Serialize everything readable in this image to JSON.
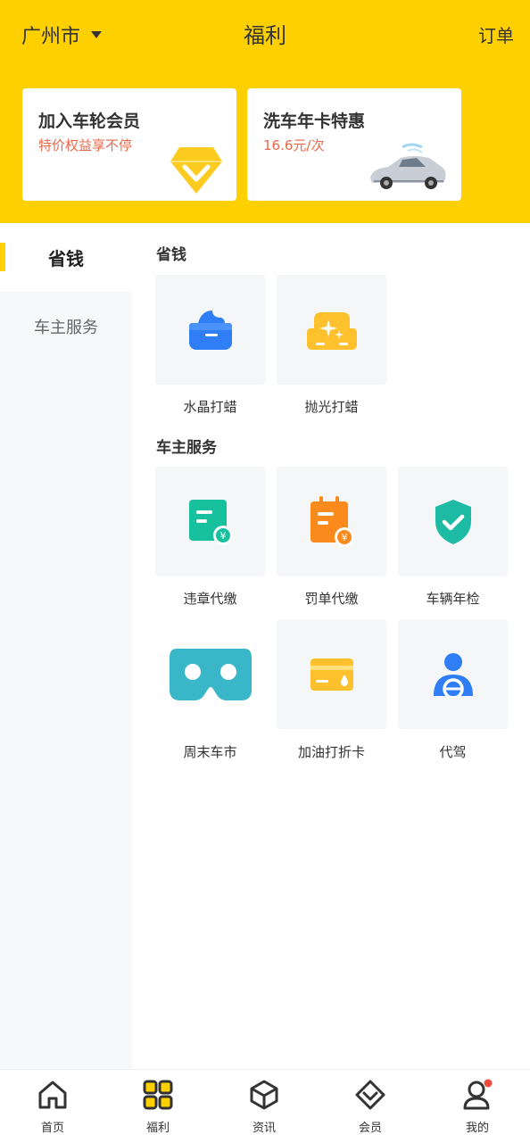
{
  "header": {
    "city": "广州市",
    "title": "福利",
    "orders": "订单"
  },
  "banners": [
    {
      "title": "加入车轮会员",
      "subtitle": "特价权益享不停",
      "icon": "diamond-icon"
    },
    {
      "title": "洗车年卡特惠",
      "subtitle": "16.6元/次",
      "icon": "car-image"
    }
  ],
  "sidebar": {
    "items": [
      {
        "label": "省钱",
        "active": true
      },
      {
        "label": "车主服务",
        "active": false
      }
    ]
  },
  "sections": [
    {
      "title": "省钱",
      "items": [
        {
          "label": "水晶打蜡",
          "icon": "wax-jar-icon",
          "color": "#2f7ef6"
        },
        {
          "label": "抛光打蜡",
          "icon": "polish-sparkle-icon",
          "color": "#fdc12e"
        }
      ]
    },
    {
      "title": "车主服务",
      "items": [
        {
          "label": "违章代缴",
          "icon": "violation-payment-icon",
          "color": "#17c19e"
        },
        {
          "label": "罚单代缴",
          "icon": "ticket-payment-icon",
          "color": "#fb8a1d"
        },
        {
          "label": "车辆年检",
          "icon": "shield-check-icon",
          "color": "#1dbba4"
        },
        {
          "label": "周末车市",
          "icon": "vr-goggles-icon",
          "color": "#39b6c8"
        },
        {
          "label": "加油打折卡",
          "icon": "fuel-card-icon",
          "color": "#fdc12e"
        },
        {
          "label": "代驾",
          "icon": "driver-icon",
          "color": "#2f7ef6"
        }
      ]
    }
  ],
  "bottom_nav": [
    {
      "label": "首页",
      "icon": "home-icon"
    },
    {
      "label": "福利",
      "icon": "grid-icon"
    },
    {
      "label": "资讯",
      "icon": "cube-icon"
    },
    {
      "label": "会员",
      "icon": "diamond-icon"
    },
    {
      "label": "我的",
      "icon": "user-icon"
    }
  ],
  "colors": {
    "brand_yellow": "#fed000",
    "subtitle_red": "#e8684a",
    "badge_red": "#f04a3a"
  }
}
